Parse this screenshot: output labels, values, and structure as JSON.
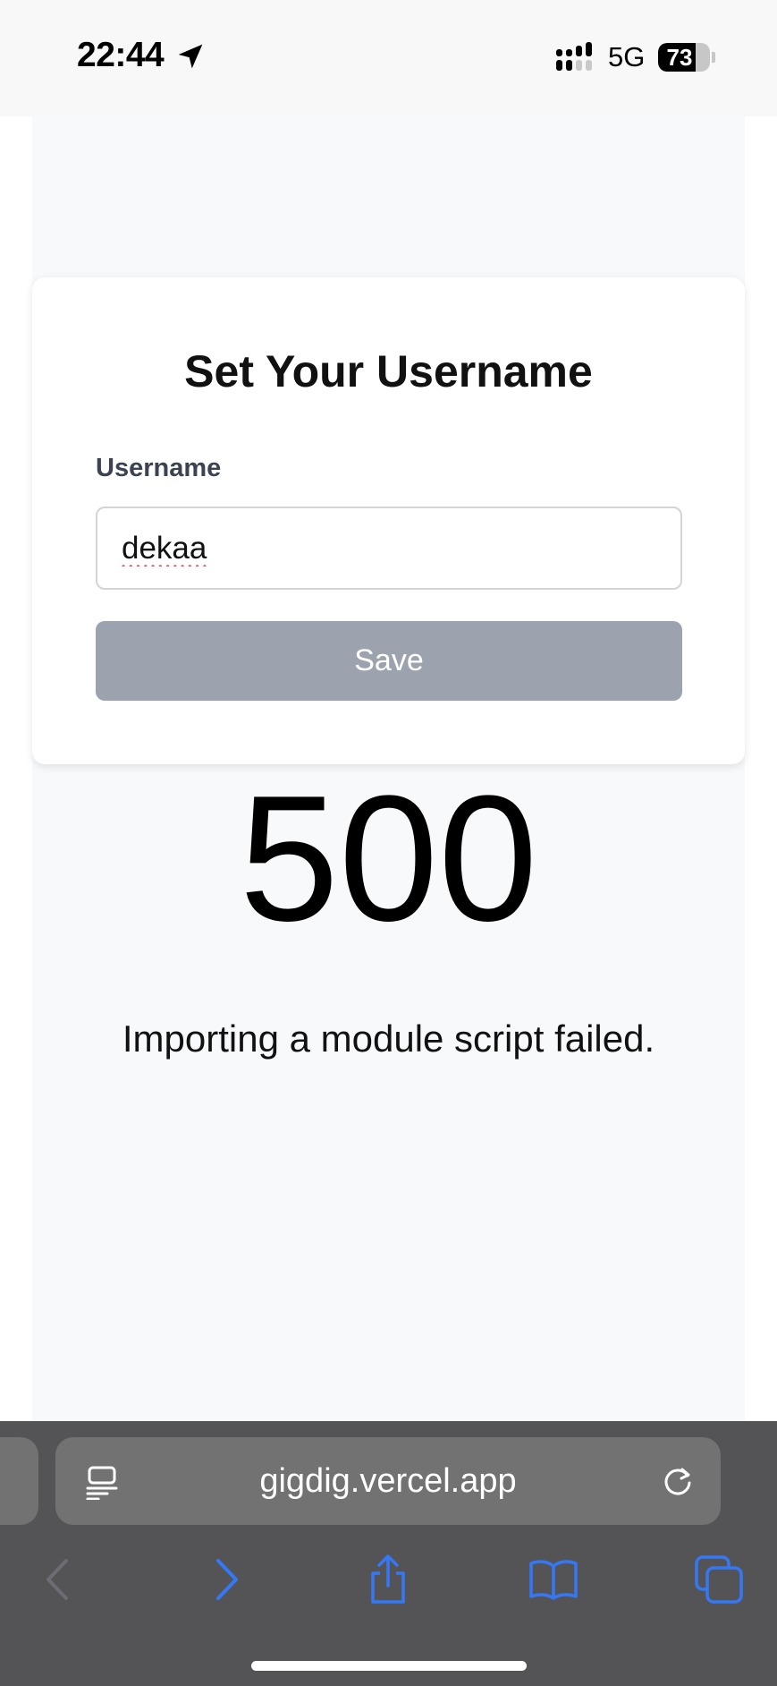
{
  "status_bar": {
    "time": "22:44",
    "network": "5G",
    "battery": "73",
    "battery_level": 0.73,
    "icons": [
      "location-arrow-icon",
      "cellular-signal-icon",
      "battery-icon"
    ]
  },
  "form": {
    "title": "Set Your Username",
    "label": "Username",
    "value": "dekaa",
    "button": "Save"
  },
  "error": {
    "code": "500",
    "message": "Importing a module script failed."
  },
  "browser": {
    "url": "gigdig.vercel.app",
    "icons": [
      "reader-icon",
      "reload-icon",
      "back-icon",
      "forward-icon",
      "share-icon",
      "bookmarks-icon",
      "tabs-icon"
    ]
  },
  "colors": {
    "accent": "#3478f6",
    "button_disabled": "#9ca3af",
    "page_bg": "#f8f9fb",
    "toolbar": "#545456"
  }
}
